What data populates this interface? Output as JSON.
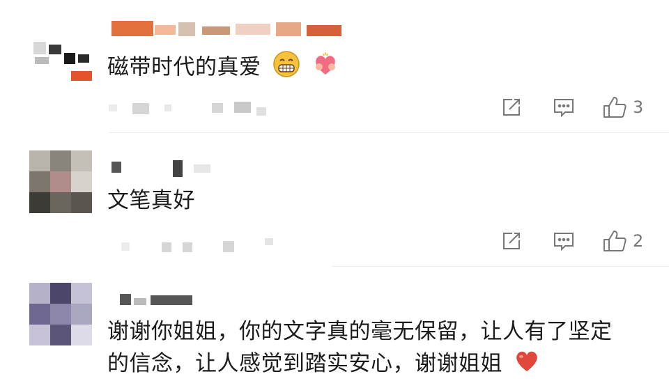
{
  "comments": [
    {
      "text": "磁带时代的真爱",
      "emoji_icons": [
        "grin-emoji-icon",
        "hug-heart-emoji-icon"
      ],
      "likes": "3"
    },
    {
      "text": "文笔真好",
      "likes": "2"
    },
    {
      "text_line1": "谢谢你姐姐，你的文字真的毫无保留，让人有了坚定",
      "text_line2": "的信念，让人感觉到踏实安心，谢谢姐姐",
      "emoji_icons": [
        "red-heart-emoji-icon"
      ]
    }
  ],
  "icons": {
    "share": "share-icon",
    "reply": "comment-icon",
    "like": "thumbs-up-icon"
  },
  "colors": {
    "text": "#1b1b1b",
    "icon": "#777777",
    "heart": "#e0463a",
    "divider": "#ececec"
  }
}
